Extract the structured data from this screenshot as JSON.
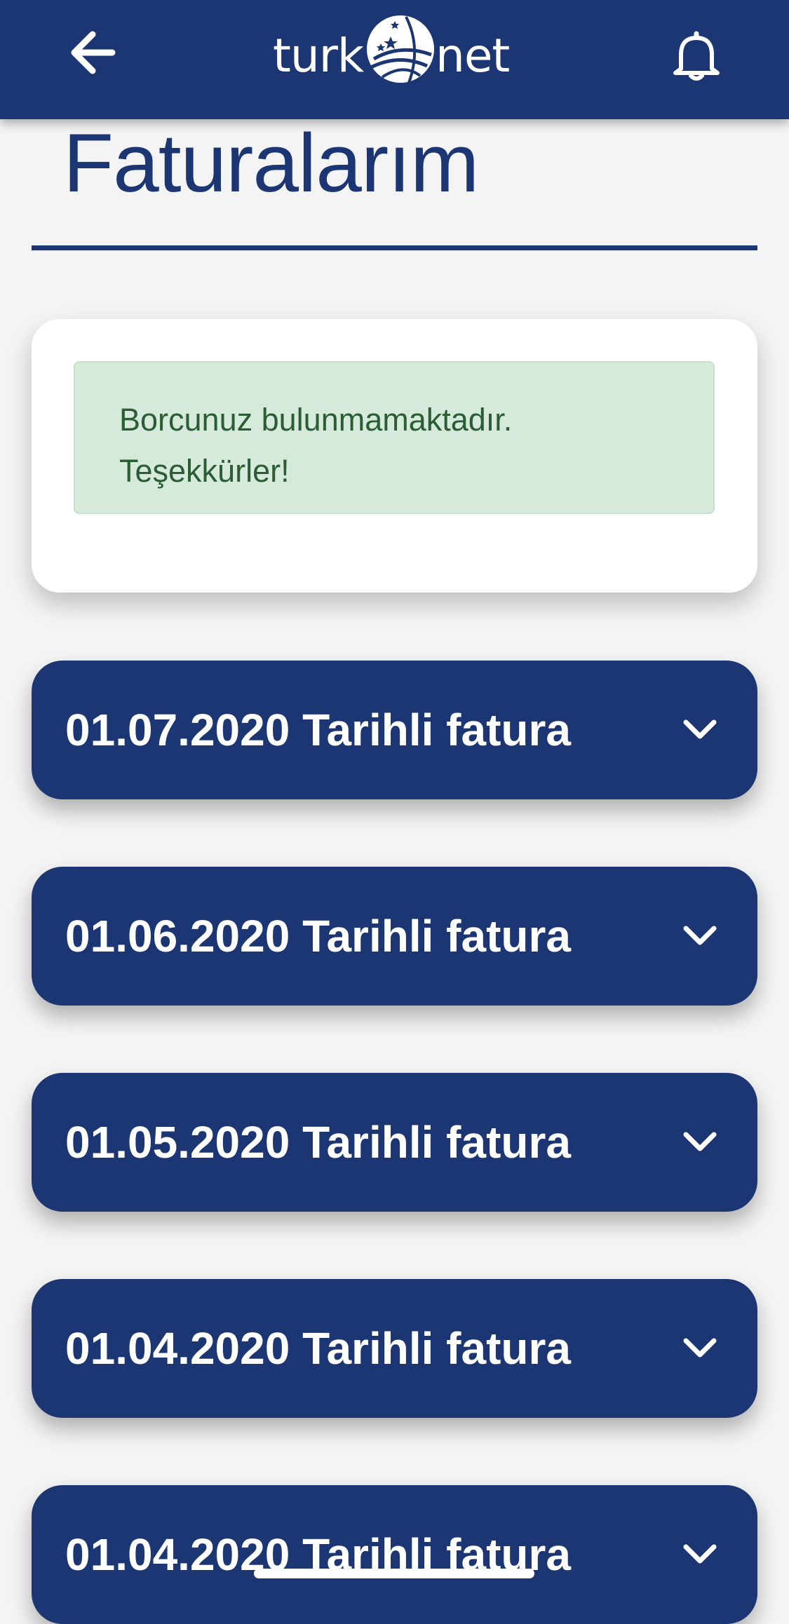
{
  "header": {
    "logo_left": "turk",
    "logo_right": "net",
    "back_icon": "arrow-left-icon",
    "bell_icon": "bell-icon",
    "background_color": "#1b3673"
  },
  "page": {
    "title": "Faturalarım"
  },
  "status": {
    "line1": "Borcunuz bulunmamaktadır.",
    "line2": "Teşekkürler!",
    "background_color": "#d5eadb",
    "text_color": "#2b5d34"
  },
  "invoices": [
    {
      "label": "01.07.2020 Tarihli fatura"
    },
    {
      "label": "01.06.2020 Tarihli fatura"
    },
    {
      "label": "01.05.2020 Tarihli fatura"
    },
    {
      "label": "01.04.2020 Tarihli fatura"
    },
    {
      "label": "01.04.2020 Tarihli fatura"
    }
  ],
  "icons": {
    "expand": "chevron-down-icon"
  }
}
